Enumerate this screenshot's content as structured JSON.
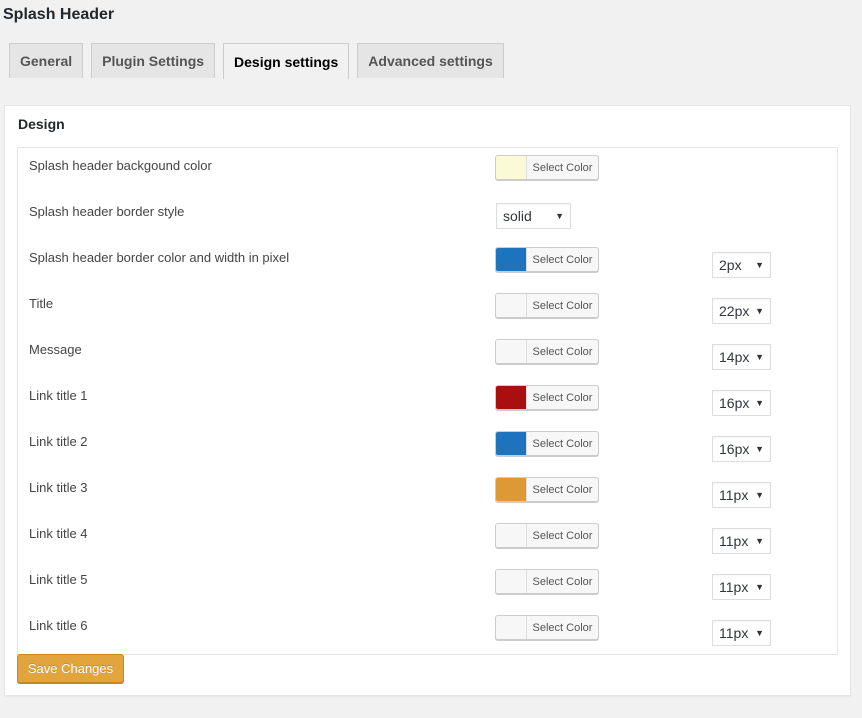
{
  "page": {
    "title": "Splash Header"
  },
  "tabs": [
    {
      "label": "General",
      "active": false
    },
    {
      "label": "Plugin Settings",
      "active": false
    },
    {
      "label": "Design settings",
      "active": true
    },
    {
      "label": "Advanced settings",
      "active": false
    }
  ],
  "panel": {
    "title": "Design"
  },
  "color_picker_label": "Select Color",
  "rows": [
    {
      "label": "Splash header backgound color",
      "color": "#fbf9d6",
      "size": null,
      "style": null
    },
    {
      "label": "Splash header border style",
      "color": null,
      "size": null,
      "style": "solid"
    },
    {
      "label": "Splash header border color and width in pixel",
      "color": "#1e73be",
      "size": "2px",
      "style": null
    },
    {
      "label": "Title",
      "color": "#f7f7f7",
      "size": "22px",
      "style": null
    },
    {
      "label": "Message",
      "color": "#f7f7f7",
      "size": "14px",
      "style": null
    },
    {
      "label": "Link title 1",
      "color": "#a81010",
      "size": "16px",
      "style": null
    },
    {
      "label": "Link title 2",
      "color": "#1e73be",
      "size": "16px",
      "style": null
    },
    {
      "label": "Link title 3",
      "color": "#dd9933",
      "size": "11px",
      "style": null
    },
    {
      "label": "Link title 4",
      "color": "#f7f7f7",
      "size": "11px",
      "style": null
    },
    {
      "label": "Link title 5",
      "color": "#f7f7f7",
      "size": "11px",
      "style": null
    },
    {
      "label": "Link title 6",
      "color": "#f7f7f7",
      "size": "11px",
      "style": null
    }
  ],
  "save_button": {
    "label": "Save Changes",
    "color": "#e2a43c"
  },
  "icons": {
    "dropdown_arrow": "▼"
  }
}
